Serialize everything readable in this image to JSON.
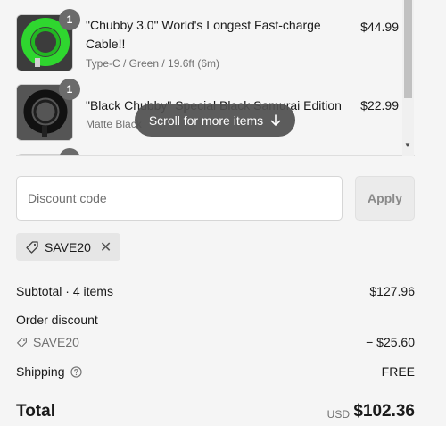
{
  "line_items": [
    {
      "title": "\"Chubby 3.0\" World's Longest Fast-charge Cable!!",
      "variant": "Type-C / Green / 19.6ft (6m)",
      "price": "$44.99",
      "quantity": "1",
      "color": "#2fd62f"
    },
    {
      "title": "\"Black Chubby\" Special Black Samurai Edition",
      "variant": "Matte Black",
      "price": "$22.99",
      "quantity": "1",
      "color": "#2a2a2a"
    }
  ],
  "scroll_hint": {
    "label": "Scroll for more items"
  },
  "discount": {
    "placeholder": "Discount code",
    "apply_label": "Apply",
    "applied_code": "SAVE20"
  },
  "summary": {
    "subtotal_label": "Subtotal · 4 items",
    "subtotal_value": "$127.96",
    "order_discount_label": "Order discount",
    "order_discount_code": "SAVE20",
    "order_discount_value": "− $25.60",
    "shipping_label": "Shipping",
    "shipping_value": "FREE",
    "total_label": "Total",
    "total_currency": "USD",
    "total_value": "$102.36"
  }
}
